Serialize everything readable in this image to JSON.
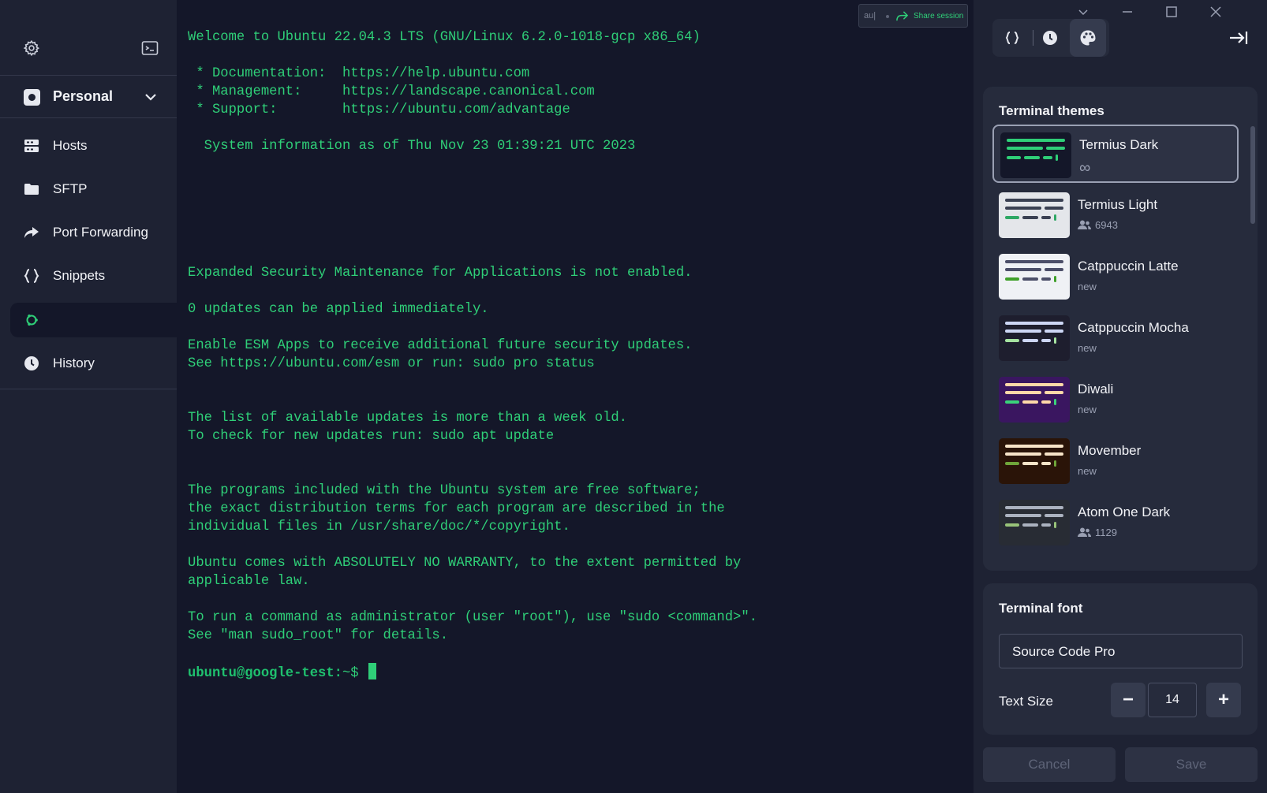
{
  "sidebar": {
    "vault_label": "Personal",
    "nav": [
      {
        "label": "Hosts",
        "icon": "hosts-icon"
      },
      {
        "label": "SFTP",
        "icon": "folder-icon"
      },
      {
        "label": "Port Forwarding",
        "icon": "port-forwarding-icon"
      },
      {
        "label": "Snippets",
        "icon": "snippets-icon"
      },
      {
        "label": "",
        "icon": "ubuntu-icon"
      },
      {
        "label": "History",
        "icon": "clock-icon"
      }
    ]
  },
  "terminal": {
    "share_prefix": "au|",
    "share_label": "Share session",
    "lines": [
      "Welcome to Ubuntu 22.04.3 LTS (GNU/Linux 6.2.0-1018-gcp x86_64)",
      "",
      " * Documentation:  https://help.ubuntu.com",
      " * Management:     https://landscape.canonical.com",
      " * Support:        https://ubuntu.com/advantage",
      "",
      "  System information as of Thu Nov 23 01:39:21 UTC 2023",
      "",
      "",
      "",
      "",
      "",
      "",
      "Expanded Security Maintenance for Applications is not enabled.",
      "",
      "0 updates can be applied immediately.",
      "",
      "Enable ESM Apps to receive additional future security updates.",
      "See https://ubuntu.com/esm or run: sudo pro status",
      "",
      "",
      "The list of available updates is more than a week old.",
      "To check for new updates run: sudo apt update",
      "",
      "",
      "The programs included with the Ubuntu system are free software;",
      "the exact distribution terms for each program are described in the",
      "individual files in /usr/share/doc/*/copyright.",
      "",
      "Ubuntu comes with ABSOLUTELY NO WARRANTY, to the extent permitted by",
      "applicable law.",
      "",
      "To run a command as administrator (user \"root\"), use \"sudo <command>\".",
      "See \"man sudo_root\" for details.",
      ""
    ],
    "prompt_user": "ubuntu@google-test:",
    "prompt_path": "~$"
  },
  "panel": {
    "themes_title": "Terminal themes",
    "themes": [
      {
        "name": "Termius Dark",
        "meta": "∞",
        "meta_icon": "infinity-icon",
        "bg": "#141729",
        "line": "#2fcf78",
        "accent": "#2fcf78"
      },
      {
        "name": "Termius Light",
        "meta": "6943",
        "meta_icon": "users-icon",
        "bg": "#e4e6ea",
        "line": "#3a4052",
        "accent": "#2fa865"
      },
      {
        "name": "Catppuccin Latte",
        "meta": "new",
        "meta_icon": "",
        "bg": "#eff1f5",
        "line": "#4c4f69",
        "accent": "#40a02b"
      },
      {
        "name": "Catppuccin Mocha",
        "meta": "new",
        "meta_icon": "",
        "bg": "#1e1e2e",
        "line": "#cdd6f4",
        "accent": "#a6e3a1"
      },
      {
        "name": "Diwali",
        "meta": "new",
        "meta_icon": "",
        "bg": "#3a1660",
        "line": "#ffd9a8",
        "accent": "#3ad27a"
      },
      {
        "name": "Movember",
        "meta": "new",
        "meta_icon": "",
        "bg": "#2a1408",
        "line": "#f7e4c8",
        "accent": "#6fa63a"
      },
      {
        "name": "Atom One Dark",
        "meta": "1129",
        "meta_icon": "users-icon",
        "bg": "#282c34",
        "line": "#abb2bf",
        "accent": "#98c379"
      }
    ],
    "font_title": "Terminal font",
    "font_value": "Source Code Pro",
    "text_size_label": "Text Size",
    "text_size_value": "14",
    "minus": "−",
    "plus": "+",
    "cancel": "Cancel",
    "save": "Save"
  }
}
